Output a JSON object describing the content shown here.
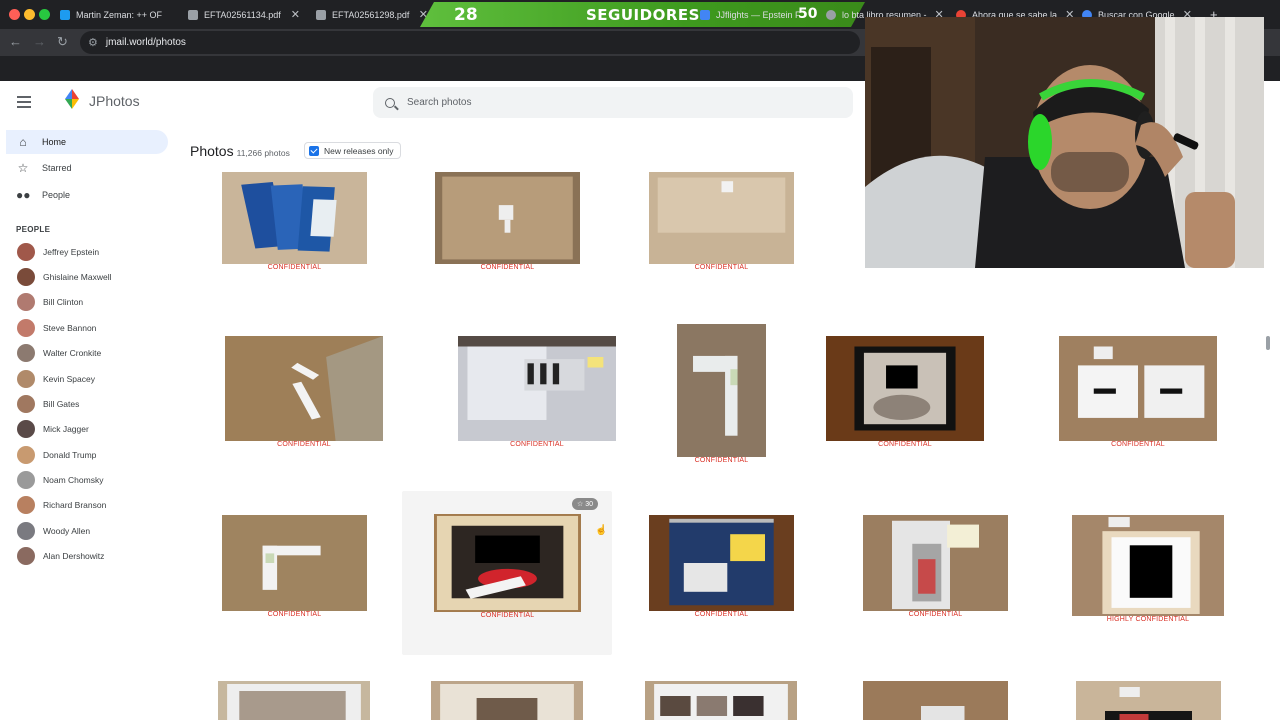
{
  "browser": {
    "tabs": [
      {
        "title": "Martin Zeman: ++ OF",
        "color": "#1d9bf0"
      },
      {
        "title": "EFTA02561134.pdf",
        "color": "#9aa0a6"
      },
      {
        "title": "EFTA02561298.pdf",
        "color": "#9aa0a6"
      },
      {
        "title": "JJflights — Epstein Fli",
        "color": "#4285f4"
      },
      {
        "title": "lo bta libro resumen -",
        "color": "#9aa0a6"
      },
      {
        "title": "Ahora que se sabe la",
        "color": "#ea4335"
      },
      {
        "title": "Buscar con Google",
        "color": "#4285f4"
      }
    ],
    "tab_close_glyph": "✕",
    "new_tab_glyph": "+",
    "stream_overlay": {
      "count": "28",
      "label": "SEGUIDORES",
      "goal": "50"
    },
    "url": "jmail.world/photos"
  },
  "app": {
    "brand": "JPhotos",
    "search_placeholder": "Search photos",
    "nav": [
      {
        "label": "Home",
        "icon": "home-icon"
      },
      {
        "label": "Starred",
        "icon": "star-icon"
      },
      {
        "label": "People",
        "icon": "people-icon"
      }
    ],
    "people_title": "PEOPLE",
    "people": [
      {
        "name": "Jeffrey Epstein",
        "color": "#a0584a"
      },
      {
        "name": "Ghislaine Maxwell",
        "color": "#7a4b3a"
      },
      {
        "name": "Bill Clinton",
        "color": "#b07a70"
      },
      {
        "name": "Steve Bannon",
        "color": "#c27a6a"
      },
      {
        "name": "Walter Cronkite",
        "color": "#8c7a70"
      },
      {
        "name": "Kevin Spacey",
        "color": "#b08a6a"
      },
      {
        "name": "Bill Gates",
        "color": "#a07860"
      },
      {
        "name": "Mick Jagger",
        "color": "#5a4a48"
      },
      {
        "name": "Donald Trump",
        "color": "#c89a70"
      },
      {
        "name": "Noam Chomsky",
        "color": "#9a9a9a"
      },
      {
        "name": "Richard Branson",
        "color": "#b88060"
      },
      {
        "name": "Woody Allen",
        "color": "#7a7a80"
      },
      {
        "name": "Alan Dershowitz",
        "color": "#8a6a60"
      }
    ],
    "heading": "Photos",
    "photo_count": "11,266 photos",
    "filter_label": "New releases only",
    "star_count": "30",
    "photos": [
      {
        "label": "CONFIDENTIAL",
        "scene": "tan-blue-bags"
      },
      {
        "label": "CONFIDENTIAL",
        "scene": "tan-label"
      },
      {
        "label": "CONFIDENTIAL",
        "scene": "tan-box-label"
      },
      {
        "label": "CONFIDENTIAL",
        "scene": "tan-corner-board"
      },
      {
        "label": "CONFIDENTIAL",
        "scene": "collage-board"
      },
      {
        "label": "CONFIDENTIAL",
        "scene": "brown-corner-piece"
      },
      {
        "label": "CONFIDENTIAL",
        "scene": "framed-redacted-dark"
      },
      {
        "label": "CONFIDENTIAL",
        "scene": "two-white-boxes"
      },
      {
        "label": "CONFIDENTIAL",
        "scene": "corner-piece-tan"
      },
      {
        "label": "CONFIDENTIAL",
        "scene": "framed-redacted-red"
      },
      {
        "label": "CONFIDENTIAL",
        "scene": "spiral-notebook"
      },
      {
        "label": "CONFIDENTIAL",
        "scene": "labeled-item"
      },
      {
        "label": "HIGHLY CONFIDENTIAL",
        "scene": "framed-redacted-white"
      },
      {
        "label": "",
        "scene": "framed-photo"
      },
      {
        "label": "",
        "scene": "framed-photo-2"
      },
      {
        "label": "",
        "scene": "collage-frame"
      },
      {
        "label": "",
        "scene": "tan-item"
      },
      {
        "label": "",
        "scene": "vhs-tape"
      }
    ]
  }
}
